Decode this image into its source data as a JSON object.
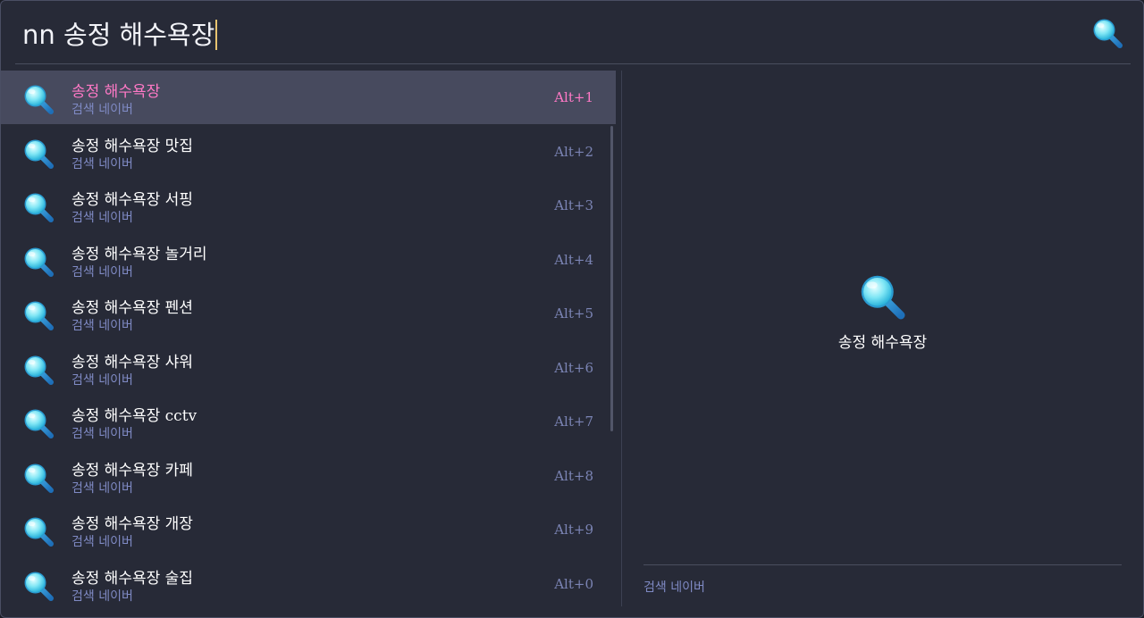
{
  "search": {
    "query": "nn 송정 해수욕장"
  },
  "results": [
    {
      "title": "송정 해수욕장",
      "subtitle": "검색 네이버",
      "shortcut": "Alt+1",
      "selected": true
    },
    {
      "title": "송정 해수욕장 맛집",
      "subtitle": "검색 네이버",
      "shortcut": "Alt+2"
    },
    {
      "title": "송정 해수욕장 서핑",
      "subtitle": "검색 네이버",
      "shortcut": "Alt+3"
    },
    {
      "title": "송정 해수욕장 놀거리",
      "subtitle": "검색 네이버",
      "shortcut": "Alt+4"
    },
    {
      "title": "송정 해수욕장 펜션",
      "subtitle": "검색 네이버",
      "shortcut": "Alt+5"
    },
    {
      "title": "송정 해수욕장 샤워",
      "subtitle": "검색 네이버",
      "shortcut": "Alt+6"
    },
    {
      "title": "송정 해수욕장 cctv",
      "subtitle": "검색 네이버",
      "shortcut": "Alt+7"
    },
    {
      "title": "송정 해수욕장 카페",
      "subtitle": "검색 네이버",
      "shortcut": "Alt+8"
    },
    {
      "title": "송정 해수욕장 개장",
      "subtitle": "검색 네이버",
      "shortcut": "Alt+9"
    },
    {
      "title": "송정 해수욕장 술집",
      "subtitle": "검색 네이버",
      "shortcut": "Alt+0"
    }
  ],
  "preview": {
    "title": "송정 해수욕장",
    "footer": "검색 네이버"
  },
  "icons": {
    "search": "magnifier-icon"
  },
  "colors": {
    "background": "#272a37",
    "selected_row": "#474a5e",
    "highlight": "#ff79c6",
    "subtitle": "#7f8ac4",
    "caret": "#e8c470"
  }
}
